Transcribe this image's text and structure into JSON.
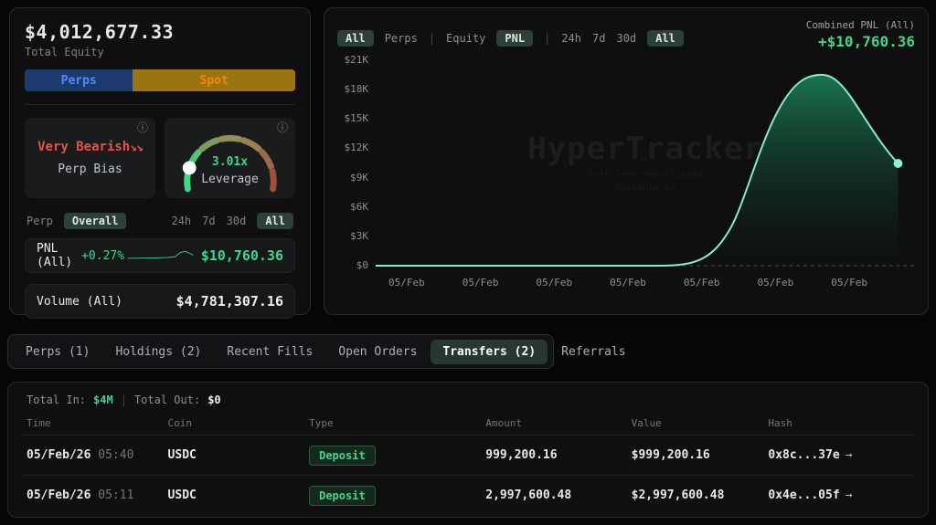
{
  "colors": {
    "accent_green": "#3fd68c",
    "mint_line": "#86efce",
    "bias_red": "#e0544a",
    "perps_blue_bg": "#1d3a6f",
    "perps_blue_text": "#4f8df5",
    "spot_gold_bg": "#9a7411",
    "spot_orange_text": "#f8860d",
    "pill_bg": "#2d4038",
    "panel_bg": "#0f0f10"
  },
  "equity": {
    "value": "$4,012,677.33",
    "label": "Total Equity"
  },
  "toggle": {
    "perps": "Perps",
    "spot": "Spot"
  },
  "bias": {
    "value": "Very Bearish",
    "arrows": "↘↘",
    "label": "Perp Bias",
    "info_icon": "ⓘ"
  },
  "leverage": {
    "value": "3.01x",
    "label": "Leverage",
    "info_icon": "ⓘ"
  },
  "scope": {
    "perp": "Perp",
    "overall": "Overall",
    "timeframes": [
      "24h",
      "7d",
      "30d",
      "All"
    ]
  },
  "pnl_row": {
    "label": "PNL (All)",
    "pct": "+0.27%",
    "value": "$10,760.36"
  },
  "volume_row": {
    "label": "Volume (All)",
    "value": "$4,781,307.16"
  },
  "chart": {
    "toggle_scope_all": "All",
    "toggle_scope_perps": "Perps",
    "toggle_mode_equity": "Equity",
    "toggle_mode_pnl": "PNL",
    "timeframes": [
      "24h",
      "7d",
      "30d",
      "All"
    ],
    "combined_label": "Combined PNL (All)",
    "combined_value": "+$10,760.36",
    "watermark_title": "HyperTracker",
    "watermark_sub1": "Real-Time Hyperliquid",
    "watermark_sub2": "Insights by"
  },
  "chart_data": {
    "type": "area",
    "title": "Combined PNL (All)",
    "x_labels": [
      "05/Feb",
      "05/Feb",
      "05/Feb",
      "05/Feb",
      "05/Feb",
      "05/Feb",
      "05/Feb"
    ],
    "y_ticks": [
      "$21K",
      "$18K",
      "$15K",
      "$12K",
      "$9K",
      "$6K",
      "$3K",
      "$0"
    ],
    "ylim": [
      0,
      21000
    ],
    "grid": false,
    "legend": "none",
    "baseline_dashed": true,
    "series": [
      {
        "name": "Combined PNL",
        "x_fraction_value_pairs": [
          [
            0.0,
            0
          ],
          [
            0.3,
            0
          ],
          [
            0.5,
            0
          ],
          [
            0.56,
            300
          ],
          [
            0.62,
            3000
          ],
          [
            0.68,
            9000
          ],
          [
            0.74,
            15500
          ],
          [
            0.8,
            18800
          ],
          [
            0.84,
            19300
          ],
          [
            0.88,
            18300
          ],
          [
            0.93,
            14500
          ],
          [
            0.975,
            10760
          ]
        ],
        "peak_value": 19300,
        "final_value": 10760.36
      }
    ]
  },
  "tabs": [
    {
      "label": "Perps (1)",
      "active": false
    },
    {
      "label": "Holdings (2)",
      "active": false
    },
    {
      "label": "Recent Fills",
      "active": false
    },
    {
      "label": "Open Orders",
      "active": false
    },
    {
      "label": "Transfers (2)",
      "active": true
    },
    {
      "label": "Referrals",
      "active": false
    }
  ],
  "transfers": {
    "total_in_label": "Total In:",
    "total_in": "$4M",
    "total_out_label": "Total Out:",
    "total_out": "$0",
    "separator": "|",
    "columns": [
      "Time",
      "Coin",
      "Type",
      "Amount",
      "Value",
      "Hash"
    ],
    "rows": [
      {
        "date": "05/Feb/26",
        "time": "05:40",
        "coin": "USDC",
        "type": "Deposit",
        "amount": "999,200.16",
        "value": "$999,200.16",
        "hash": "0x8c...37e",
        "arrow": "→"
      },
      {
        "date": "05/Feb/26",
        "time": "05:11",
        "coin": "USDC",
        "type": "Deposit",
        "amount": "2,997,600.48",
        "value": "$2,997,600.48",
        "hash": "0x4e...05f",
        "arrow": "→"
      }
    ]
  }
}
